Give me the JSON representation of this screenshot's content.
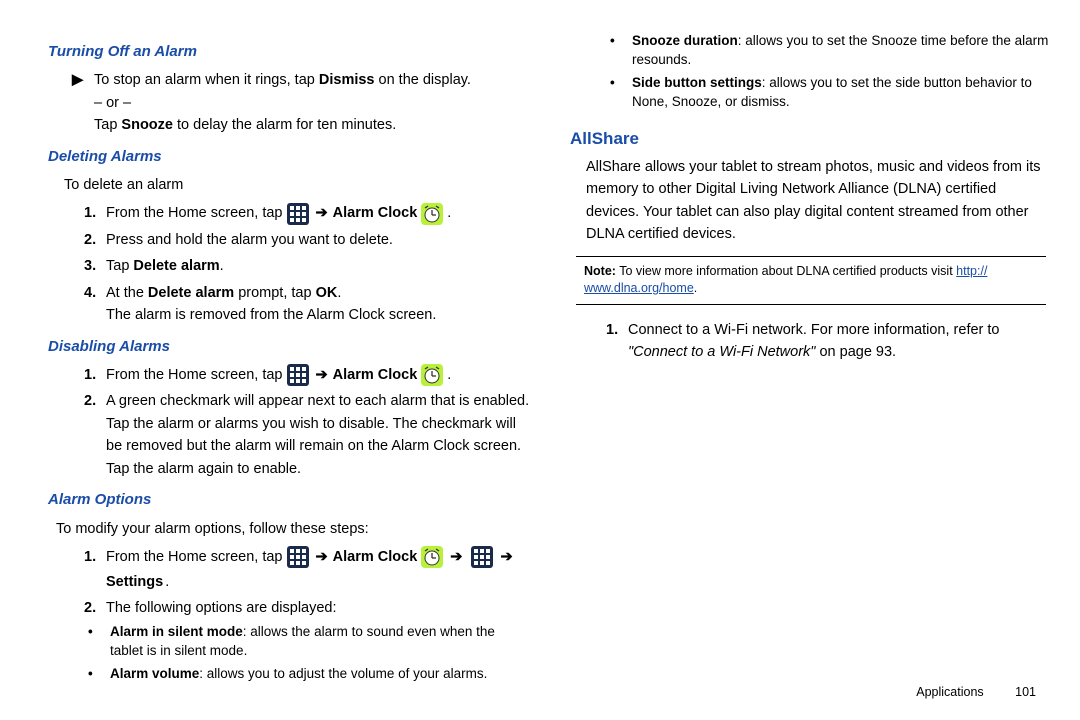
{
  "left": {
    "h_turn_off": "Turning Off an Alarm",
    "turn_off_text_a": "To stop an alarm when it rings, tap ",
    "turn_off_dismiss": "Dismiss",
    "turn_off_text_b": " on the display.",
    "turn_off_or": "– or –",
    "turn_off_snooze_a": "Tap ",
    "turn_off_snooze_b": "Snooze",
    "turn_off_snooze_c": " to delay the alarm for ten minutes.",
    "h_delete": "Deleting Alarms",
    "delete_intro": "To delete an alarm",
    "s1_a": "From the Home screen, tap ",
    "alarm_clock": "Alarm Clock",
    "s2": "Press and hold the alarm you want to delete.",
    "s3_a": "Tap ",
    "s3_b": "Delete alarm",
    "s3_c": ".",
    "s4_a": "At the ",
    "s4_b": "Delete alarm",
    "s4_c": " prompt, tap ",
    "s4_d": "OK",
    "s4_e": ".",
    "s4_after": "The alarm is removed from the Alarm Clock screen.",
    "h_disable": "Disabling Alarms",
    "d2": " A green checkmark will appear next to each alarm that is enabled. Tap the alarm or alarms you wish to disable. The checkmark will be removed but the alarm will remain on the Alarm Clock screen. Tap the alarm again to enable."
  },
  "right": {
    "h_options": "Alarm Options",
    "opt_intro": "To modify your alarm options, follow these steps:",
    "opt1_a": "From the Home screen, tap ",
    "settings": "Settings",
    "opt2": "The following options are displayed:",
    "b1_t": "Alarm in silent mode",
    "b1_d": ": allows the alarm to sound even when the tablet is in silent mode.",
    "b2_t": "Alarm volume",
    "b2_d": ": allows you to adjust the volume of your alarms.",
    "b3_t": "Snooze duration",
    "b3_d": ": allows you to set the Snooze time before the alarm resounds.",
    "b4_t": "Side button settings",
    "b4_d": ": allows you to set the side button behavior to None, Snooze, or dismiss.",
    "h_allshare": "AllShare",
    "allshare_para": "AllShare allows your tablet to stream photos, music and videos from its memory to other Digital Living Network Alliance (DLNA) certified devices. Your tablet can also play digital content streamed from other DLNA certified devices.",
    "note_a": "Note:",
    "note_b": " To view more information about DLNA certified products visit ",
    "note_link_a": "http://",
    "note_link_b": "www.dlna.org/home",
    "note_c": ".",
    "as1": "Connect to a Wi-Fi network. For more information, refer to ",
    "as1_ref": "\"Connect to a Wi-Fi Network\"",
    "as1_ref2": "  on page 93."
  },
  "footer": {
    "label": "Applications",
    "page": "101"
  },
  "num": {
    "n1": "1.",
    "n2": "2.",
    "n3": "3.",
    "n4": "4."
  }
}
